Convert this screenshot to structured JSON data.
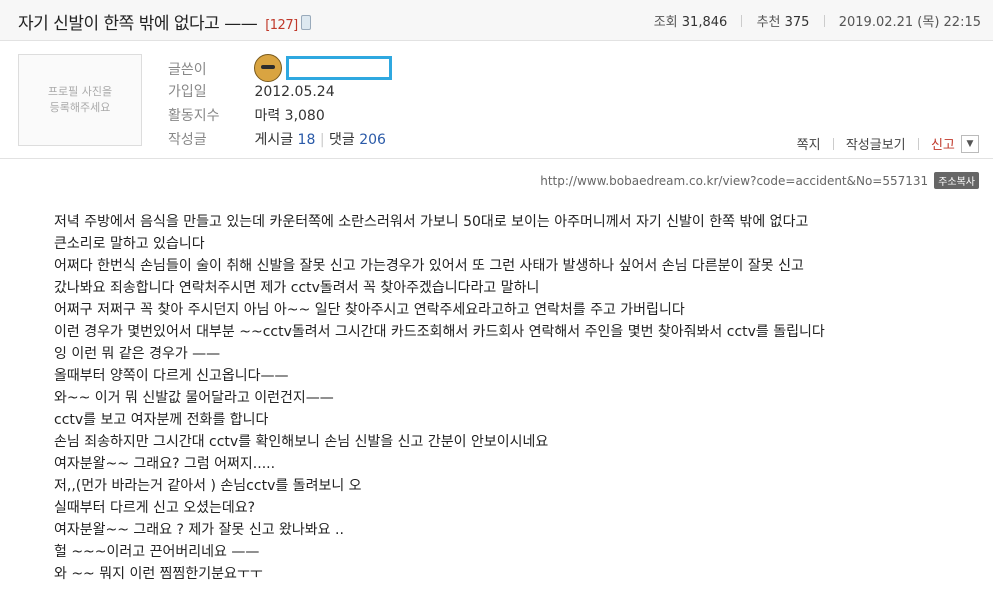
{
  "post": {
    "title": "자기 신발이 한쪽 밖에 없다고 ——",
    "comment_count": "[127]",
    "views_label": "조회",
    "views": "31,846",
    "recommend_label": "추천",
    "recommend": "375",
    "datetime": "2019.02.21 (목) 22:15"
  },
  "profile": {
    "photo_placeholder": "프로필 사진을\n등록해주세요",
    "author_label": "글쓴이",
    "joined_label": "가입일",
    "joined": "2012.05.24",
    "activity_label": "활동지수",
    "activity": "마력 3,080",
    "posts_label": "작성글",
    "posts_text": "게시글",
    "posts_count": "18",
    "comments_text": "댓글",
    "comments_count": "206"
  },
  "actions": {
    "message": "쪽지",
    "view_posts": "작성글보기",
    "report": "신고"
  },
  "url": {
    "text": "http://www.bobaedream.co.kr/view?code=accident&No=557131",
    "copy_label": "주소복사"
  },
  "body_lines": [
    "저녁 주방에서 음식을 만들고 있는데 카운터쪽에 소란스러워서 가보니 50대로 보이는 아주머니께서 자기 신발이 한쪽 밖에 없다고",
    "큰소리로 말하고 있습니다",
    "어쩌다 한번식 손님들이 술이 취해 신발을 잘못 신고 가는경우가 있어서 또 그런 사태가 발생하나 싶어서 손님 다른분이 잘못 신고",
    "갔나봐요 죄송합니다 연락처주시면 제가 cctv돌려서 꼭 찾아주겠습니다라고 말하니",
    "어쩌구 저쩌구 꼭 찾아 주시던지 아님 아~~ 일단 찾아주시고 연락주세요라고하고 연락처를 주고 가버립니다",
    "이런 경우가 몇번있어서 대부분 ~~cctv돌려서 그시간대 카드조회해서 카드회사 연락해서 주인을 몇번 찾아줘봐서 cctv를 돌립니다",
    "잉 이런 뭐 같은 경우가 ——",
    "올때부터 양쪽이 다르게 신고옵니다——",
    "와~~ 이거 뭐 신발값 물어달라고 이런건지——",
    "cctv를 보고 여자분께 전화를 합니다",
    "손님 죄송하지만 그시간대 cctv를 확인해보니 손님 신발을 신고 간분이 안보이시네요",
    "여자분왈~~ 그래요? 그럼 어쩌지.....",
    "저,,(먼가 바라는거 같아서 ) 손님cctv를 돌려보니 오",
    "실때부터 다르게 신고 오셨는데요?",
    "여자분왈~~ 그래요 ? 제가 잘못 신고 왔나봐요 ..",
    "헐 ~~~이러고 끈어버리네요 ——",
    "와 ~~ 뭐지 이런 찜찜한기분요ㅜㅜ"
  ]
}
